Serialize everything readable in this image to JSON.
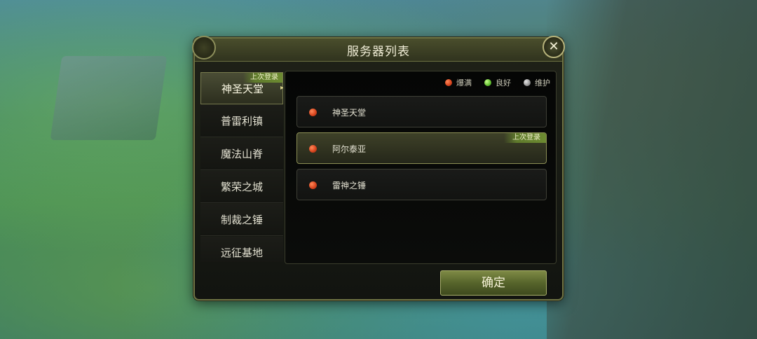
{
  "dialog": {
    "title": "服务器列表",
    "close_icon": "✕",
    "confirm_label": "确定"
  },
  "colors": {
    "full": "#d9461f",
    "good": "#66c234",
    "maintenance": "#9b9b9b",
    "accent": "#6d8b31"
  },
  "legend": {
    "full": "爆满",
    "good": "良好",
    "maintenance": "维护"
  },
  "zones": {
    "last_login_tag": "上次登录",
    "items": [
      {
        "label": "神圣天堂",
        "selected": true
      },
      {
        "label": "普雷利镇"
      },
      {
        "label": "魔法山脊"
      },
      {
        "label": "繁荣之城"
      },
      {
        "label": "制裁之锤"
      },
      {
        "label": "远征基地"
      }
    ]
  },
  "servers": {
    "last_login_tag": "上次登录",
    "items": [
      {
        "name": "神圣天堂",
        "status": "full"
      },
      {
        "name": "阿尔泰亚",
        "status": "full",
        "selected": true
      },
      {
        "name": "雷神之锤",
        "status": "full"
      }
    ]
  }
}
